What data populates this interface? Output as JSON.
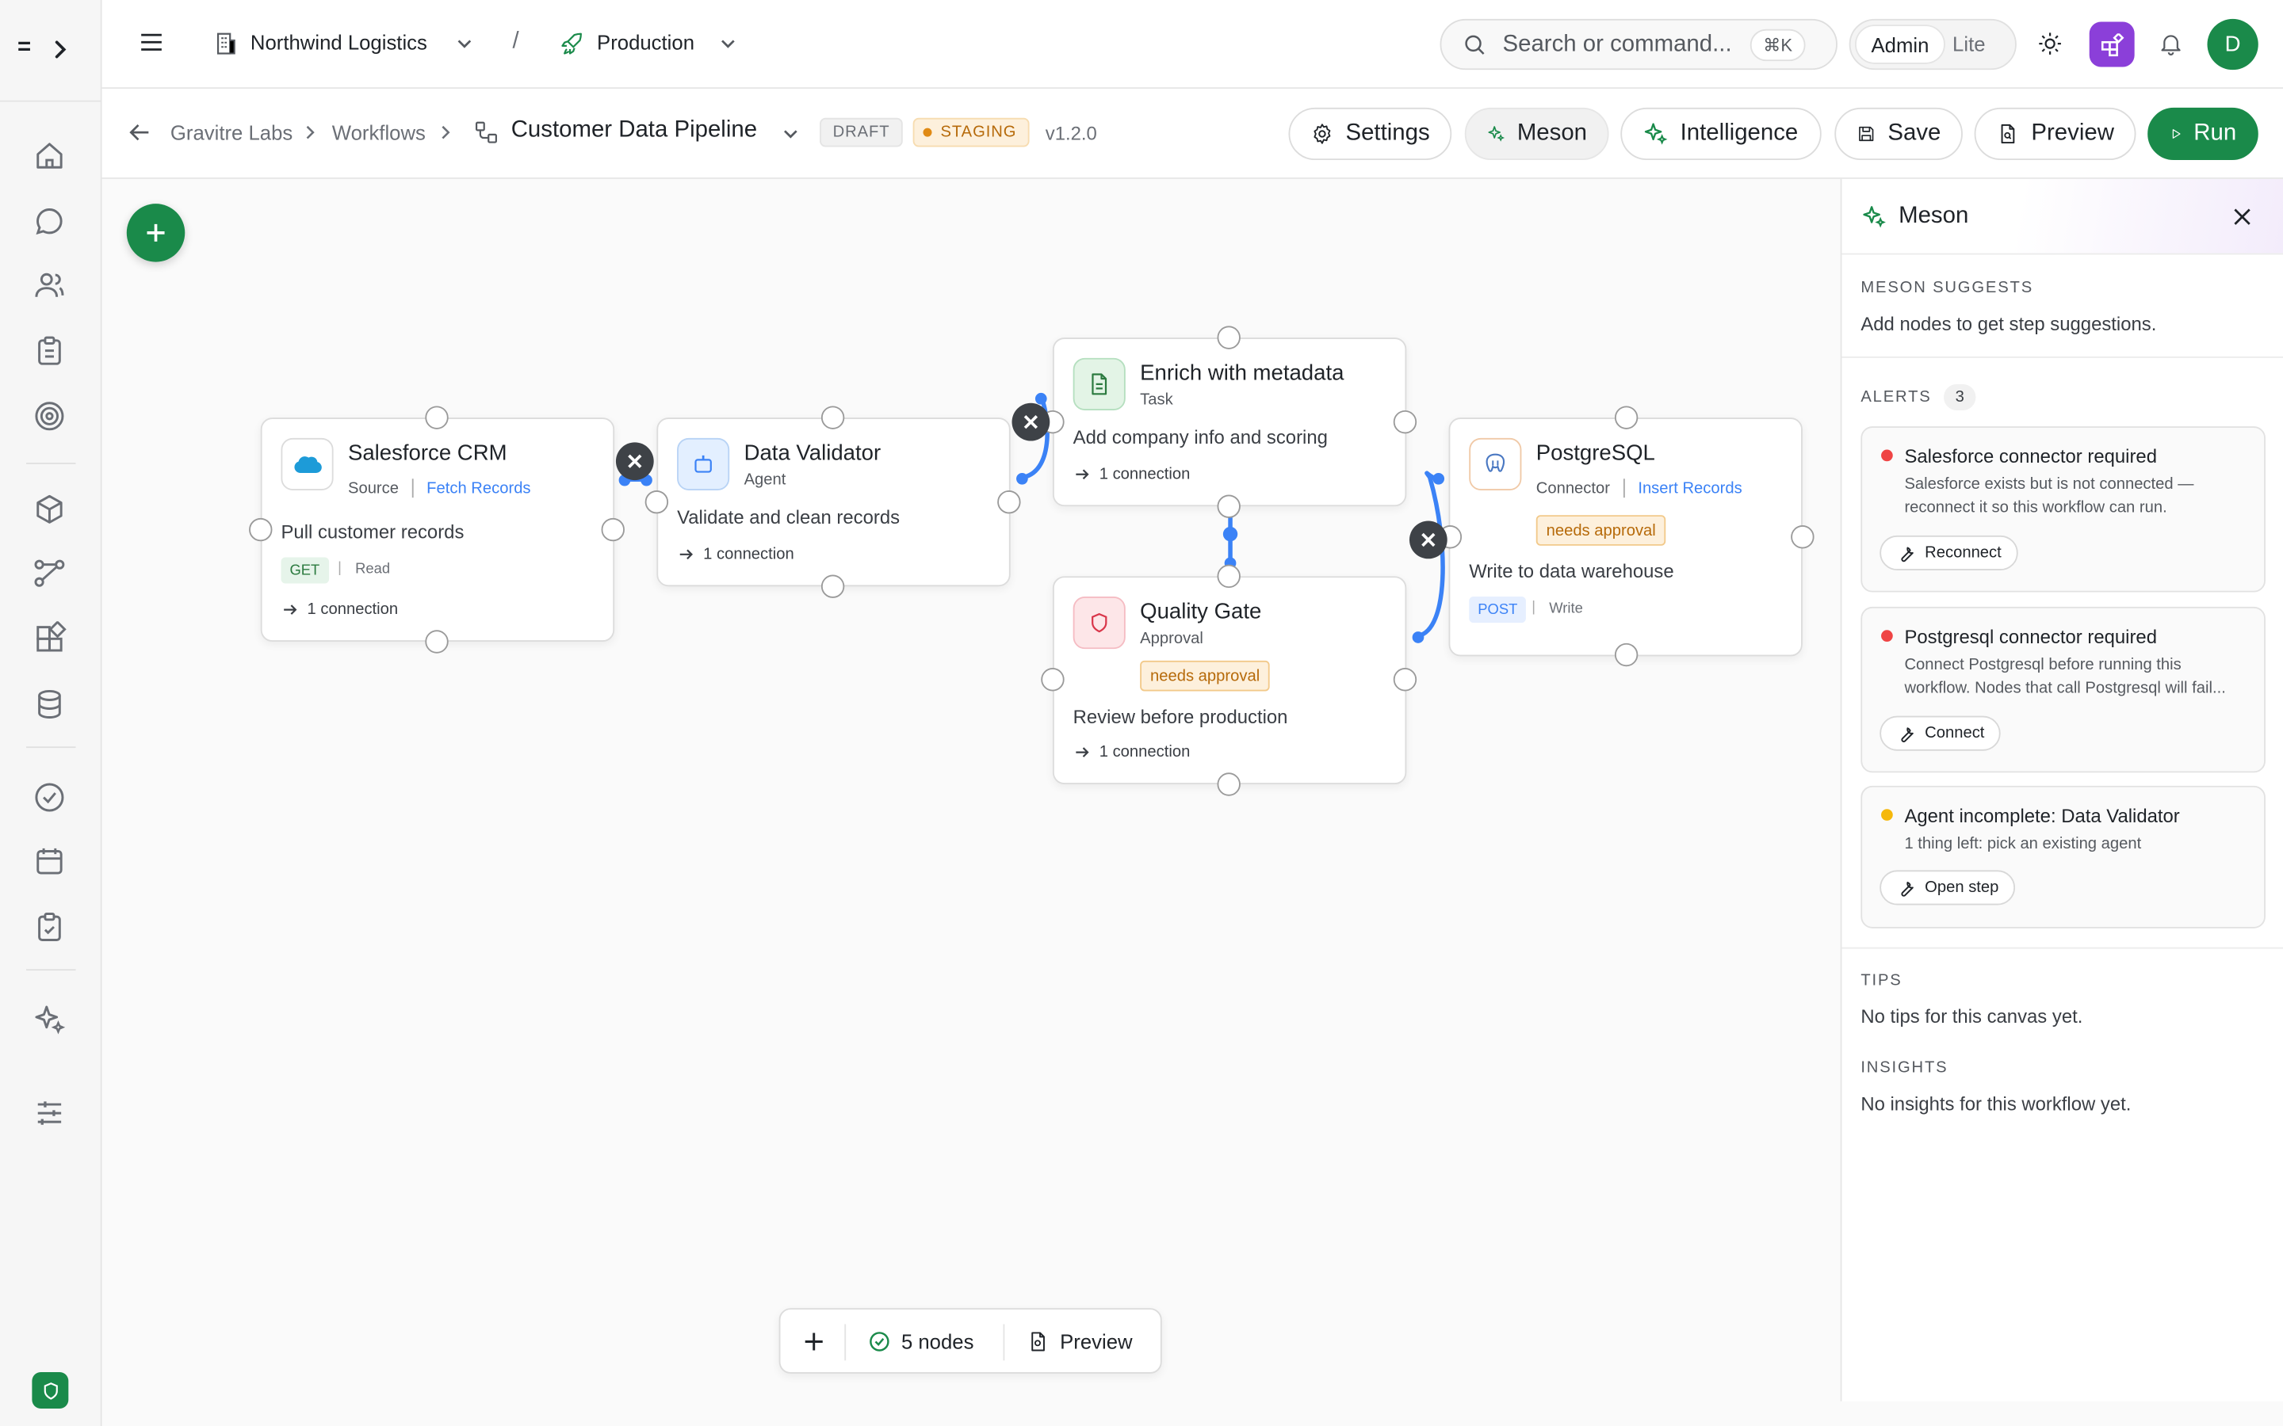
{
  "colors": {
    "accent": "#1a8a4a",
    "link": "#3b82f6",
    "danger": "#ef4444",
    "warning": "#f59e0b",
    "edge": "#3b82f6"
  },
  "rail": {
    "toggle_glyph": "=",
    "items": [
      {
        "name": "home-icon"
      },
      {
        "name": "chat-icon"
      },
      {
        "name": "users-icon"
      },
      {
        "name": "clipboard-icon"
      },
      {
        "name": "target-icon"
      },
      {
        "name": "package-icon"
      },
      {
        "name": "workflow-icon"
      },
      {
        "name": "apps-icon"
      },
      {
        "name": "database-icon"
      },
      {
        "name": "check-circle-icon"
      },
      {
        "name": "calendar-icon"
      },
      {
        "name": "clipboard-check-icon"
      },
      {
        "name": "sparkle-icon"
      },
      {
        "name": "sliders-icon"
      }
    ]
  },
  "topbar": {
    "org": "Northwind Logistics",
    "separator": "/",
    "env": "Production",
    "search_placeholder": "Search or command...",
    "shortcut": "⌘K",
    "mode_admin": "Admin",
    "mode_lite": "Lite",
    "avatar": "D"
  },
  "subbar": {
    "breadcrumb": [
      "Gravitre Labs",
      "Workflows"
    ],
    "title": "Customer Data Pipeline",
    "status": "DRAFT",
    "env_badge": "STAGING",
    "version": "v1.2.0",
    "buttons": {
      "settings": "Settings",
      "meson": "Meson",
      "intelligence": "Intelligence",
      "save": "Save",
      "preview": "Preview",
      "run": "Run"
    }
  },
  "nodes": {
    "salesforce": {
      "title": "Salesforce CRM",
      "type": "Source",
      "action": "Fetch Records",
      "desc": "Pull customer records",
      "method": "GET",
      "mode": "Read",
      "conn": "1 connection"
    },
    "validator": {
      "title": "Data Validator",
      "type": "Agent",
      "desc": "Validate and clean records",
      "conn": "1 connection"
    },
    "enrich": {
      "title": "Enrich with metadata",
      "type": "Task",
      "desc": "Add company info and scoring",
      "conn": "1 connection"
    },
    "quality": {
      "title": "Quality Gate",
      "type": "Approval",
      "badge": "needs approval",
      "desc": "Review before production",
      "conn": "1 connection"
    },
    "postgres": {
      "title": "PostgreSQL",
      "type": "Connector",
      "action": "Insert Records",
      "badge": "needs approval",
      "desc": "Write to data warehouse",
      "method": "POST",
      "mode": "Write"
    }
  },
  "bottombar": {
    "nodes": "5 nodes",
    "preview": "Preview"
  },
  "panel": {
    "title": "Meson",
    "suggest_title": "MESON SUGGESTS",
    "suggest_text": "Add nodes to get step suggestions.",
    "alerts_title": "ALERTS",
    "alerts_count": "3",
    "alerts": [
      {
        "title": "Salesforce connector required",
        "body1": "Salesforce exists but is not connected —",
        "body2": "reconnect it so this workflow can run.",
        "action": "Reconnect",
        "color": "#ef4444"
      },
      {
        "title": "Postgresql connector required",
        "body1": "Connect Postgresql before running this",
        "body2": "workflow. Nodes that call Postgresql will fail...",
        "action": "Connect",
        "color": "#ef4444"
      },
      {
        "title": "Agent incomplete: Data Validator",
        "body1": "1 thing left: pick an existing agent",
        "action": "Open step",
        "color": "#f59e0b"
      }
    ],
    "tips_title": "TIPS",
    "tips_text": "No tips for this canvas yet.",
    "insights_title": "INSIGHTS",
    "insights_text": "No insights for this workflow yet."
  }
}
